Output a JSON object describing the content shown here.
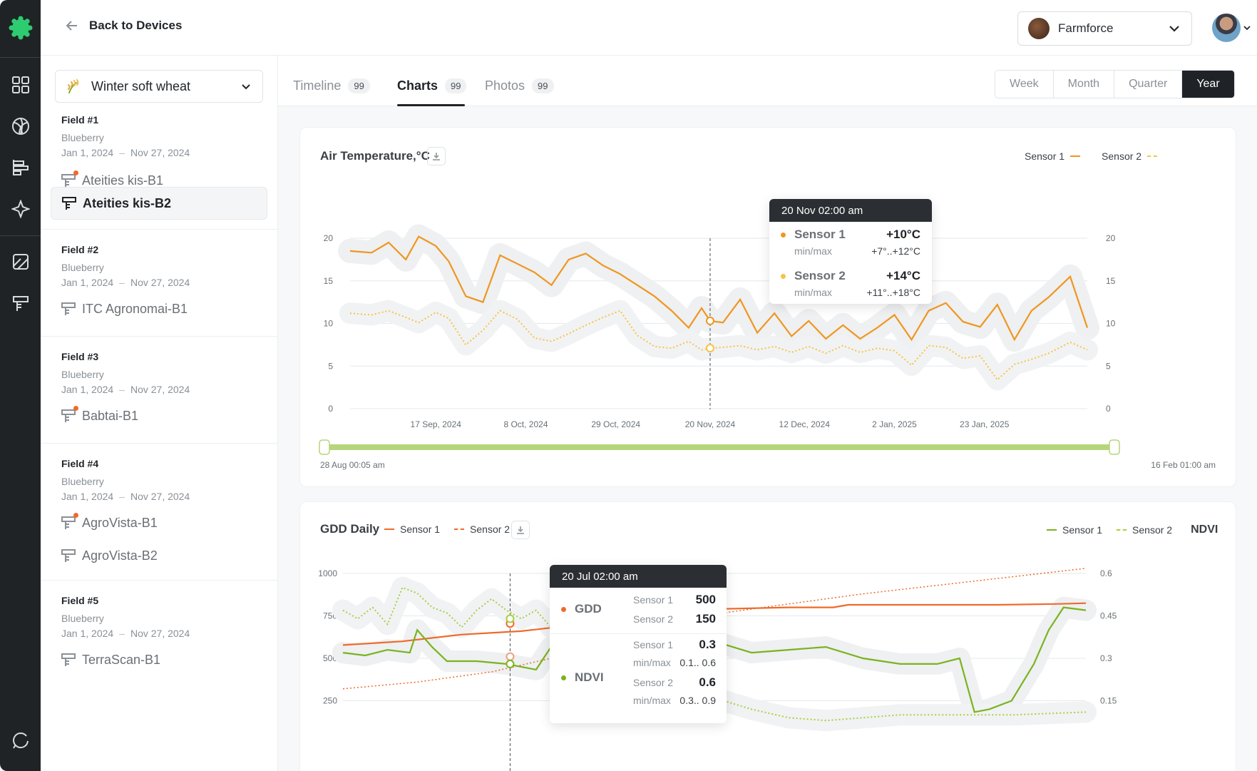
{
  "header": {
    "back_label": "Back to Devices",
    "farm_name": "Farmforce"
  },
  "sidebar": {
    "crop": "Winter soft wheat",
    "fields": [
      {
        "title": "Field #1",
        "crop": "Blueberry",
        "start": "Jan 1, 2024",
        "end": "Nov 27, 2024",
        "devices": [
          {
            "name": "Ateities kis-B1",
            "alert": true,
            "selected": false
          },
          {
            "name": "Ateities kis-B2",
            "alert": false,
            "selected": true
          }
        ]
      },
      {
        "title": "Field #2",
        "crop": "Blueberry",
        "start": "Jan 1, 2024",
        "end": "Nov 27, 2024",
        "devices": [
          {
            "name": "ITC Agronomai-B1",
            "alert": false,
            "selected": false
          }
        ]
      },
      {
        "title": "Field #3",
        "crop": "Blueberry",
        "start": "Jan 1, 2024",
        "end": "Nov 27, 2024",
        "devices": [
          {
            "name": "Babtai-B1",
            "alert": true,
            "selected": false
          }
        ]
      },
      {
        "title": "Field #4",
        "crop": "Blueberry",
        "start": "Jan 1, 2024",
        "end": "Nov 27, 2024",
        "devices": [
          {
            "name": "AgroVista-B1",
            "alert": true,
            "selected": false
          },
          {
            "name": "AgroVista-B2",
            "alert": false,
            "selected": false
          }
        ]
      },
      {
        "title": "Field #5",
        "crop": "Blueberry",
        "start": "Jan 1, 2024",
        "end": "Nov 27, 2024",
        "devices": [
          {
            "name": "TerraScan-B1",
            "alert": false,
            "selected": false
          }
        ]
      }
    ]
  },
  "tabs": [
    {
      "label": "Timeline",
      "count": "99",
      "active": false
    },
    {
      "label": "Charts",
      "count": "99",
      "active": true
    },
    {
      "label": "Photos",
      "count": "99",
      "active": false
    }
  ],
  "periods": [
    {
      "label": "Week",
      "active": false
    },
    {
      "label": "Month",
      "active": false
    },
    {
      "label": "Quarter",
      "active": false
    },
    {
      "label": "Year",
      "active": true
    }
  ],
  "colors": {
    "sensor1_temp": "#f0961e",
    "sensor2_temp": "#f7c443",
    "gdd_sensor1": "#ef6a2a",
    "ndvi_sensor1": "#7ab31e",
    "ndvi_sensor2": "#a9cf3e",
    "range_bar": "#b6d57a",
    "tooltip_header": "#2b2f33"
  },
  "air_temp": {
    "title": "Air Temperature,°C",
    "legend": {
      "s1": "Sensor 1",
      "s2": "Sensor 2"
    },
    "range_start": "28 Aug 00:05 am",
    "range_end": "16 Feb 01:00 am",
    "tooltip": {
      "date": "20 Nov 02:00 am",
      "s1_name": "Sensor 1",
      "s1_value": "+10°C",
      "s1_minmax_label": "min/max",
      "s1_minmax": "+7°..+12°C",
      "s2_name": "Sensor 2",
      "s2_value": "+14°C",
      "s2_minmax_label": "min/max",
      "s2_minmax": "+11°..+18°C"
    }
  },
  "gdd": {
    "title": "GDD Daily",
    "legend": {
      "s1": "Sensor 1",
      "s2": "Sensor 2",
      "ndvi_s1": "Sensor 1",
      "ndvi_s2": "Sensor 2",
      "ndvi_label": "NDVI"
    },
    "tooltip": {
      "date": "20 Jul 02:00 am",
      "gdd_label": "GDD",
      "gdd_s1_name": "Sensor 1",
      "gdd_s1_value": "500",
      "gdd_s2_name": "Sensor 2",
      "gdd_s2_value": "150",
      "ndvi_label": "NDVI",
      "ndvi_s1_name": "Sensor 1",
      "ndvi_s1_value": "0.3",
      "ndvi_s1_minmax_label": "min/max",
      "ndvi_s1_minmax": "0.1.. 0.6",
      "ndvi_s2_name": "Sensor 2",
      "ndvi_s2_value": "0.6",
      "ndvi_s2_minmax_label": "min/max",
      "ndvi_s2_minmax": "0.3.. 0.9"
    }
  },
  "chart_data": [
    {
      "type": "line",
      "title": "Air Temperature,°C",
      "xlabel": "",
      "ylabel": "",
      "x_ticks": [
        "17 Sep, 2024",
        "8 Oct, 2024",
        "29 Oct, 2024",
        "20 Nov, 2024",
        "12 Dec, 2024",
        "2 Jan, 2025",
        "23 Jan, 2025"
      ],
      "y_ticks": [
        0,
        5,
        10,
        15,
        20
      ],
      "ylim": [
        0,
        20
      ],
      "y2_ticks": [
        0,
        5,
        10,
        15,
        20
      ],
      "x_range": [
        "2024-08-28",
        "2025-02-16"
      ],
      "grid": true,
      "legend_position": "top-right",
      "series": [
        {
          "name": "Sensor 1",
          "style": "solid",
          "x": [
            "2024-08-28",
            "2024-09-02",
            "2024-09-06",
            "2024-09-10",
            "2024-09-13",
            "2024-09-17",
            "2024-09-20",
            "2024-09-24",
            "2024-09-28",
            "2024-10-02",
            "2024-10-06",
            "2024-10-10",
            "2024-10-14",
            "2024-10-18",
            "2024-10-22",
            "2024-10-26",
            "2024-10-30",
            "2024-11-03",
            "2024-11-07",
            "2024-11-11",
            "2024-11-15",
            "2024-11-18",
            "2024-11-20",
            "2024-11-23",
            "2024-11-27",
            "2024-12-01",
            "2024-12-05",
            "2024-12-09",
            "2024-12-13",
            "2024-12-17",
            "2024-12-21",
            "2024-12-25",
            "2024-12-29",
            "2025-01-02",
            "2025-01-06",
            "2025-01-10",
            "2025-01-14",
            "2025-01-18",
            "2025-01-22",
            "2025-01-26",
            "2025-01-30",
            "2025-02-03",
            "2025-02-07",
            "2025-02-12",
            "2025-02-16"
          ],
          "y": [
            18.5,
            18.3,
            19.5,
            17.5,
            20.2,
            19.1,
            17.3,
            13.2,
            12.5,
            18,
            17,
            16,
            14.5,
            17.5,
            18.2,
            16.8,
            15.8,
            14.5,
            13.2,
            11.5,
            9.5,
            11.8,
            10.3,
            10.1,
            12.8,
            8.9,
            11.2,
            8.5,
            10.3,
            8.2,
            9.8,
            8.2,
            9.5,
            11,
            8.1,
            11.5,
            12.4,
            10.2,
            9.6,
            12.2,
            8.1,
            11.5,
            13.1,
            15.5,
            9.5
          ]
        },
        {
          "name": "Sensor 2",
          "style": "dashed",
          "x": [
            "2024-08-28",
            "2024-09-02",
            "2024-09-06",
            "2024-09-10",
            "2024-09-13",
            "2024-09-17",
            "2024-09-20",
            "2024-09-24",
            "2024-09-28",
            "2024-10-02",
            "2024-10-06",
            "2024-10-10",
            "2024-10-14",
            "2024-10-18",
            "2024-10-22",
            "2024-10-26",
            "2024-10-30",
            "2024-11-03",
            "2024-11-07",
            "2024-11-11",
            "2024-11-15",
            "2024-11-18",
            "2024-11-20",
            "2024-11-23",
            "2024-11-27",
            "2024-12-01",
            "2024-12-05",
            "2024-12-09",
            "2024-12-13",
            "2024-12-17",
            "2024-12-21",
            "2024-12-25",
            "2024-12-29",
            "2025-01-02",
            "2025-01-06",
            "2025-01-10",
            "2025-01-14",
            "2025-01-18",
            "2025-01-22",
            "2025-01-26",
            "2025-01-30",
            "2025-02-03",
            "2025-02-07",
            "2025-02-12",
            "2025-02-16"
          ],
          "y": [
            11.2,
            11,
            11.5,
            10.7,
            10.1,
            11.3,
            10.6,
            7.5,
            9.2,
            11.5,
            10.5,
            8.3,
            7.9,
            8.8,
            9.8,
            10.7,
            11.5,
            8.6,
            7.3,
            7.1,
            7.9,
            6.9,
            7.1,
            7.2,
            7.4,
            6.9,
            7.3,
            6.6,
            7.3,
            6.5,
            7.4,
            6.6,
            7.1,
            6.8,
            5.1,
            7.4,
            7.2,
            5.9,
            6.2,
            3.4,
            5.2,
            5.8,
            6.5,
            7.8,
            6.9
          ]
        }
      ],
      "highlight": {
        "x": "2024-11-20",
        "label": "20 Nov 02:00 am"
      }
    },
    {
      "type": "line",
      "title": "GDD Daily",
      "xlabel": "",
      "ylabel": "",
      "y_ticks": [
        250,
        500,
        750,
        1000
      ],
      "ylim": [
        0,
        1000
      ],
      "y2_ticks": [
        0.15,
        0.3,
        0.45,
        0.6
      ],
      "y2lim": [
        0,
        0.6
      ],
      "grid": true,
      "legend_position": "top",
      "series": [
        {
          "name": "Sensor 1",
          "axis": "left",
          "style": "solid",
          "x": [
            0,
            0.08,
            0.16,
            0.24,
            0.28,
            0.32,
            0.36,
            0.4,
            0.44,
            0.5,
            0.6,
            0.66,
            0.68,
            0.7,
            0.8,
            0.88,
            0.96,
            1.0
          ],
          "y": [
            578,
            600,
            640,
            660,
            680,
            700,
            720,
            740,
            765,
            790,
            800,
            800,
            815,
            815,
            815,
            815,
            820,
            825
          ]
        },
        {
          "name": "Sensor 2",
          "axis": "left",
          "style": "dashed",
          "x": [
            0,
            0.1,
            0.2,
            0.28,
            0.32,
            0.36,
            0.4,
            0.5,
            0.6,
            0.7,
            0.8,
            0.9,
            1.0
          ],
          "y": [
            320,
            360,
            420,
            500,
            560,
            640,
            700,
            760,
            820,
            880,
            930,
            980,
            1030
          ]
        },
        {
          "name": "Sensor 1",
          "axis": "right",
          "style": "solid",
          "x": [
            0,
            0.03,
            0.06,
            0.09,
            0.1,
            0.12,
            0.14,
            0.18,
            0.22,
            0.26,
            0.27,
            0.28,
            0.3,
            0.34,
            0.38,
            0.42,
            0.46,
            0.5,
            0.55,
            0.6,
            0.65,
            0.7,
            0.75,
            0.8,
            0.83,
            0.85,
            0.87,
            0.9,
            0.93,
            0.95,
            0.97,
            1.0
          ],
          "y": [
            0.32,
            0.31,
            0.33,
            0.32,
            0.4,
            0.34,
            0.29,
            0.29,
            0.28,
            0.26,
            0.3,
            0.34,
            0.35,
            0.36,
            0.38,
            0.35,
            0.35,
            0.36,
            0.32,
            0.33,
            0.34,
            0.3,
            0.28,
            0.28,
            0.3,
            0.11,
            0.12,
            0.15,
            0.28,
            0.4,
            0.48,
            0.47
          ]
        },
        {
          "name": "Sensor 2",
          "axis": "right",
          "style": "dashed",
          "x": [
            0,
            0.02,
            0.04,
            0.06,
            0.08,
            0.1,
            0.12,
            0.14,
            0.16,
            0.18,
            0.2,
            0.22,
            0.24,
            0.26,
            0.28,
            0.3,
            0.34,
            0.38,
            0.42,
            0.46,
            0.5,
            0.55,
            0.6,
            0.65,
            0.7,
            0.75,
            0.8,
            0.9,
            1.0
          ],
          "y": [
            0.47,
            0.44,
            0.48,
            0.42,
            0.55,
            0.53,
            0.48,
            0.46,
            0.41,
            0.47,
            0.51,
            0.47,
            0.44,
            0.47,
            0.41,
            0.36,
            0.34,
            0.3,
            0.24,
            0.19,
            0.16,
            0.12,
            0.09,
            0.08,
            0.09,
            0.1,
            0.1,
            0.1,
            0.11
          ]
        }
      ],
      "highlight": {
        "label": "20 Jul 02:00 am"
      }
    }
  ]
}
